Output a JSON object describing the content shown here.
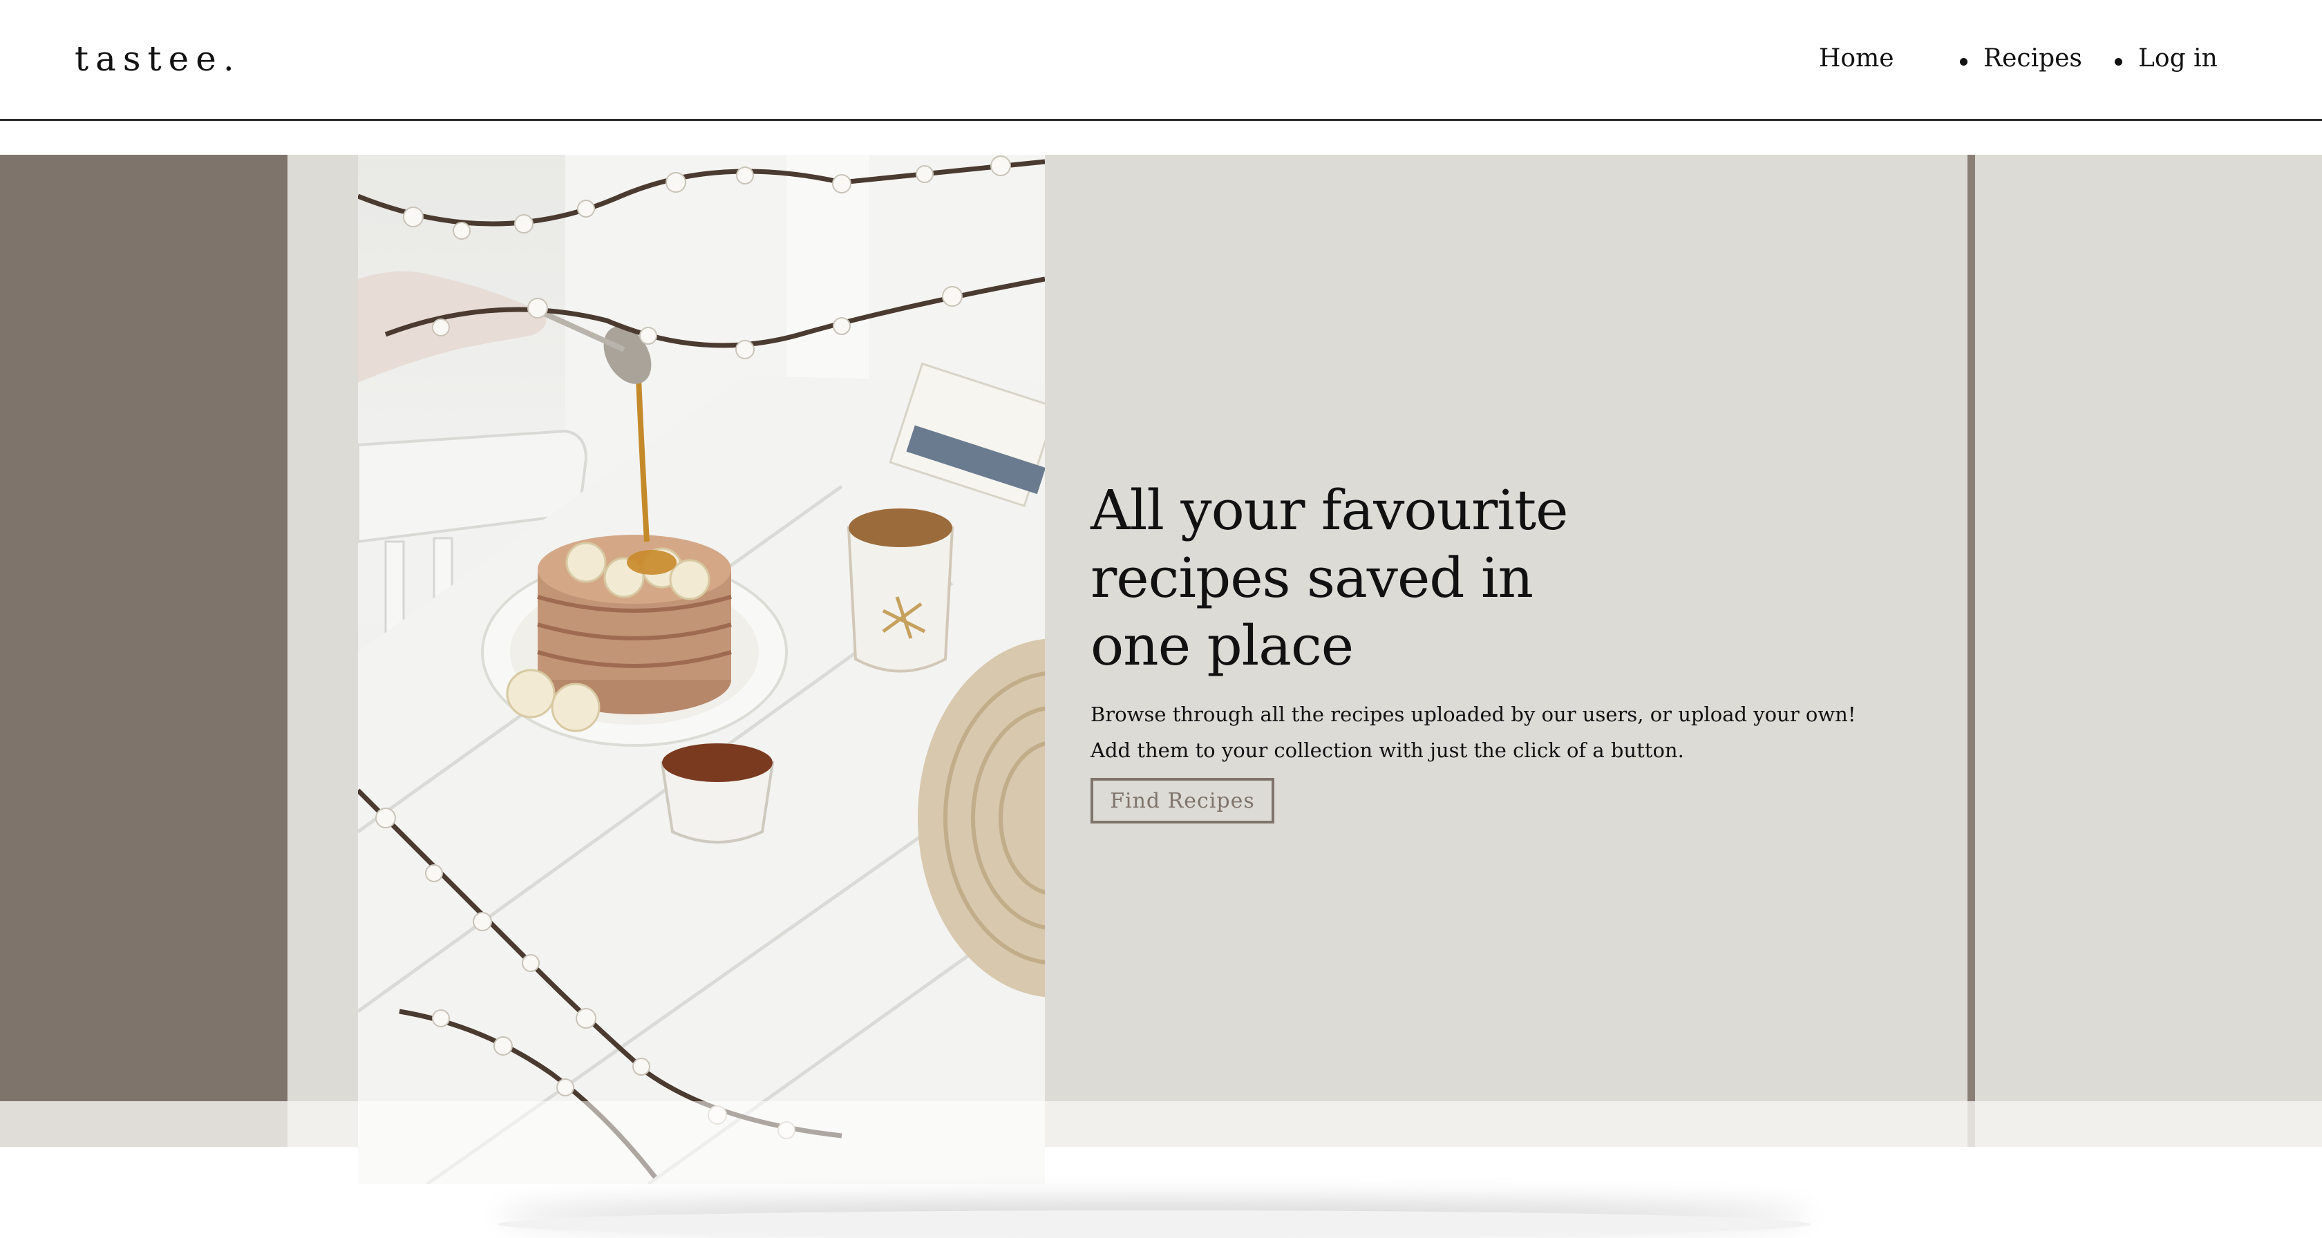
{
  "header": {
    "logo": "tastee.",
    "nav": [
      {
        "label": "Home"
      },
      {
        "label": "Recipes"
      },
      {
        "label": "Log in"
      }
    ]
  },
  "hero": {
    "title_lines": [
      "All your favourite",
      "recipes saved in",
      "one place"
    ],
    "description_lines": [
      "Browse through all the recipes uploaded by our users, or upload your own!",
      "Add them to your collection with just the click of a button."
    ],
    "cta_label": "Find Recipes",
    "image_subject": "pancakes-with-bananas-and-tea-photo"
  },
  "colors": {
    "brand_brown": "#7f746b",
    "panel_beige": "#dcdbd6",
    "text": "#111111",
    "header_border": "#2b2b2b"
  }
}
